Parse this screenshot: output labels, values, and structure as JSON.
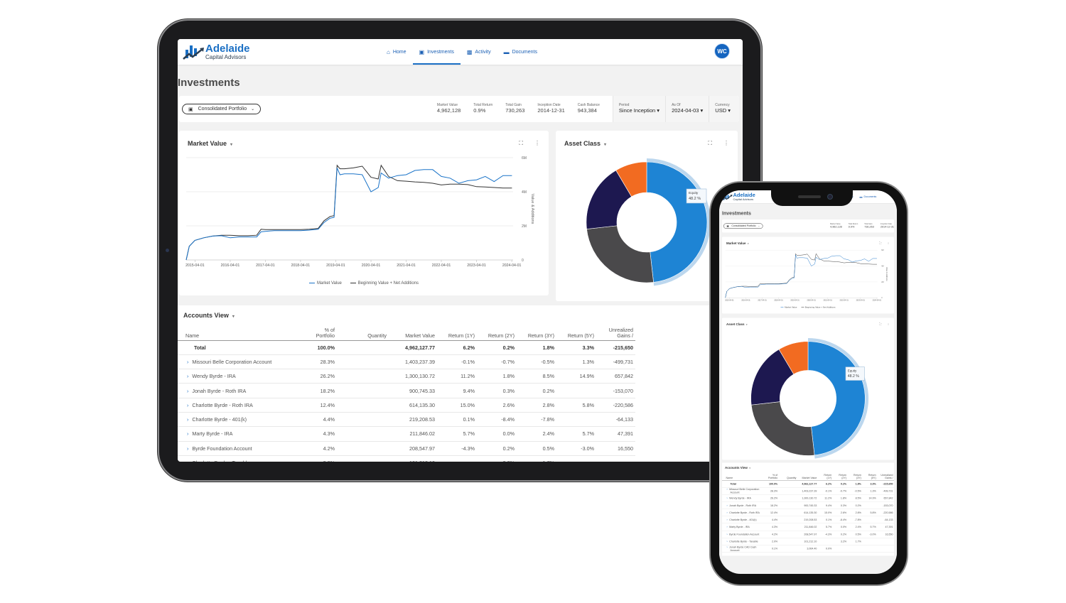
{
  "brand": {
    "name": "Adelaide",
    "subtitle": "Capital Advisors"
  },
  "nav": [
    {
      "label": "Home",
      "icon": "home-icon",
      "active": false
    },
    {
      "label": "Investments",
      "icon": "briefcase-icon",
      "active": true
    },
    {
      "label": "Activity",
      "icon": "chart-icon",
      "active": false
    },
    {
      "label": "Documents",
      "icon": "folder-icon",
      "active": false
    }
  ],
  "user": {
    "initials": "WC"
  },
  "page": {
    "title": "Investments"
  },
  "summary": {
    "portfolio": "Consolidated Portfolio",
    "stats": [
      {
        "label": "Market Value",
        "value": "4,962,128"
      },
      {
        "label": "Total Return",
        "value": "0.9%"
      },
      {
        "label": "Total Gain",
        "value": "730,263"
      },
      {
        "label": "Inception Date",
        "value": "2014-12-31"
      },
      {
        "label": "Cash Balance",
        "value": "943,384"
      }
    ],
    "selectors": [
      {
        "label": "Period",
        "value": "Since Inception"
      },
      {
        "label": "As Of",
        "value": "2024-04-03"
      },
      {
        "label": "Currency",
        "value": "USD"
      }
    ]
  },
  "market_value_card": {
    "title": "Market Value"
  },
  "asset_class_card": {
    "title": "Asset Class"
  },
  "chart_data": [
    {
      "type": "line",
      "title": "Market Value",
      "ylabel": "Value & Additions",
      "ylim": [
        0,
        6000000
      ],
      "yticks": [
        "0",
        "2M",
        "4M",
        "6M"
      ],
      "ytick_values": [
        0,
        2000000,
        4000000,
        6000000
      ],
      "xlim": [
        "2014-12-31",
        "2024-04-15"
      ],
      "xticks": [
        "2015-04-01",
        "2016-04-01",
        "2017-04-01",
        "2018-04-01",
        "2019-04-01",
        "2020-04-01",
        "2021-04-01",
        "2022-04-01",
        "2023-04-01",
        "2024-04-01"
      ],
      "grid": true,
      "legend": "bottom",
      "x": [
        "2014-12-31",
        "2015-02-01",
        "2015-04-01",
        "2015-07-01",
        "2015-10-01",
        "2016-01-01",
        "2016-04-01",
        "2016-07-01",
        "2016-10-01",
        "2017-01-01",
        "2017-02-15",
        "2017-04-01",
        "2017-07-01",
        "2018-01-01",
        "2018-04-01",
        "2018-07-01",
        "2018-10-01",
        "2018-12-01",
        "2019-02-01",
        "2019-03-15",
        "2019-04-15",
        "2019-05-15",
        "2019-07-01",
        "2019-10-01",
        "2020-01-01",
        "2020-04-01",
        "2020-06-15",
        "2020-07-15",
        "2020-10-01",
        "2021-01-01",
        "2021-04-01",
        "2021-07-01",
        "2021-10-01",
        "2022-01-01",
        "2022-04-01",
        "2022-07-01",
        "2022-10-01",
        "2023-01-01",
        "2023-04-01",
        "2023-07-01",
        "2023-10-01",
        "2024-01-01",
        "2024-04-03"
      ],
      "series": [
        {
          "name": "Market Value",
          "color": "#1a73c8",
          "values": [
            0,
            800000,
            1150000,
            1300000,
            1400000,
            1420000,
            1300000,
            1350000,
            1350000,
            1350000,
            1650000,
            1680000,
            1720000,
            1720000,
            1720000,
            1750000,
            1800000,
            2200000,
            2450000,
            2500000,
            5400000,
            5000000,
            5050000,
            5050000,
            5000000,
            4000000,
            4250000,
            5100000,
            4800000,
            4950000,
            5000000,
            5250000,
            5300000,
            5300000,
            4900000,
            4800000,
            4500000,
            4650000,
            4700000,
            4900000,
            4600000,
            4950000,
            4950000
          ]
        },
        {
          "name": "Beginning Value + Net Additions",
          "color": "#333333",
          "values": [
            0,
            800000,
            1150000,
            1300000,
            1400000,
            1450000,
            1450000,
            1420000,
            1420000,
            1450000,
            1800000,
            1780000,
            1780000,
            1780000,
            1780000,
            1800000,
            1850000,
            2300000,
            2550000,
            2600000,
            5550000,
            5350000,
            5350000,
            5400000,
            5500000,
            4850000,
            4750000,
            5550000,
            4900000,
            4650000,
            4620000,
            4580000,
            4550000,
            4500000,
            4400000,
            4450000,
            4450000,
            4420000,
            4300000,
            4280000,
            4250000,
            4220000,
            4220000
          ]
        }
      ]
    },
    {
      "type": "pie",
      "title": "Asset Class",
      "donut": true,
      "slices": [
        {
          "name": "Equity",
          "value": 48.2,
          "color": "#1e84d4",
          "highlighted": true
        },
        {
          "name": "",
          "value": 25.0,
          "color": "#4a494b"
        },
        {
          "name": "",
          "value": 18.3,
          "color": "#1d1850"
        },
        {
          "name": "",
          "value": 8.5,
          "color": "#f26b21"
        }
      ],
      "tooltip": {
        "label": "Equity",
        "value": "48.2 %"
      }
    }
  ],
  "accounts": {
    "title": "Accounts View",
    "columns": [
      "Name",
      "% of Portfolio",
      "Quantity",
      "Market Value",
      "Return (1Y)",
      "Return (2Y)",
      "Return (3Y)",
      "Return (5Y)",
      "Unrealized Gains /"
    ],
    "total": [
      "Total",
      "100.0%",
      "",
      "4,962,127.77",
      "6.2%",
      "0.2%",
      "1.8%",
      "3.3%",
      "-215,650"
    ],
    "rows": [
      [
        "Missouri Belle Corporation Account",
        "28.3%",
        "",
        "1,403,237.39",
        "-0.1%",
        "-0.7%",
        "-0.5%",
        "1.3%",
        "-499,731"
      ],
      [
        "Wendy Byrde - IRA",
        "26.2%",
        "",
        "1,300,130.72",
        "11.2%",
        "1.8%",
        "8.5%",
        "14.9%",
        "657,842"
      ],
      [
        "Jonah Byrde - Roth IRA",
        "18.2%",
        "",
        "900,745.33",
        "9.4%",
        "0.3%",
        "0.2%",
        "",
        "-153,070"
      ],
      [
        "Charlotte Byrde - Roth IRA",
        "12.4%",
        "",
        "614,135.30",
        "15.0%",
        "2.6%",
        "2.8%",
        "5.8%",
        "-220,586"
      ],
      [
        "Charlotte Byrde - 401(k)",
        "4.4%",
        "",
        "219,208.53",
        "0.1%",
        "-8.4%",
        "-7.8%",
        "",
        "-64,133"
      ],
      [
        "Marty Byrde - IRA",
        "4.3%",
        "",
        "211,846.02",
        "5.7%",
        "0.0%",
        "2.4%",
        "5.7%",
        "47,391"
      ],
      [
        "Byrde Foundation Account",
        "4.2%",
        "",
        "208,547.97",
        "-4.3%",
        "0.2%",
        "0.5%",
        "-3.0%",
        "16,550"
      ],
      [
        "Charlotte Byrde - Taxable",
        "2.0%",
        "",
        "101,212.10",
        "",
        "3.2%",
        "1.7%",
        "",
        ""
      ],
      [
        "Jonah Byrde CAD Cash Account",
        "0.1%",
        "",
        "3,064.40",
        "0.0%",
        "",
        "",
        "",
        ""
      ]
    ]
  }
}
